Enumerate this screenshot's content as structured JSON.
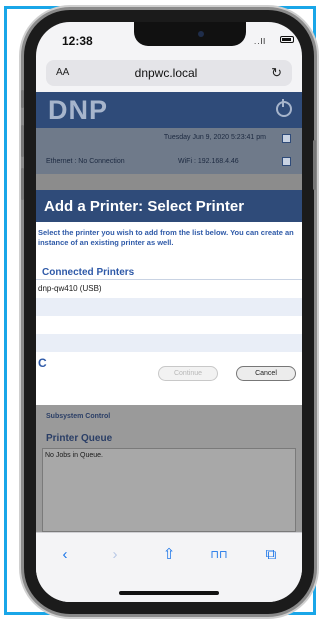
{
  "status": {
    "time": "12:38",
    "signal": "..ll"
  },
  "browser": {
    "text_size_label": "AA",
    "url": "dnpwc.local",
    "reload_icon": "reload-icon"
  },
  "header": {
    "logo": "DNP",
    "power_icon": "power-icon"
  },
  "info": {
    "datetime": "Tuesday Jun 9, 2020 5:23:41 pm",
    "ethernet": "Ethernet : No Connection",
    "wifi": "WiFi : 192.168.4.46"
  },
  "modal": {
    "title": "Add a Printer: Select Printer",
    "description": "Select the printer you wish to add from the list below. You can create an instance of an existing printer as well.",
    "section_title": "Connected Printers",
    "printers": [
      "dnp-qw410 (USB)",
      "",
      "",
      "",
      ""
    ],
    "spinner": "C",
    "continue_label": "Continue",
    "cancel_label": "Cancel"
  },
  "background": {
    "subsystem_control": "Subsystem Control",
    "printer_queue_title": "Printer Queue",
    "printer_queue_text": "No Jobs in Queue."
  },
  "toolbar": {
    "back": "‹",
    "forward": "›",
    "share": "⇧",
    "bookmarks": "⊓⊓",
    "tabs": "⧉"
  },
  "colors": {
    "border": "#19a6e8",
    "brand": "#2f4b79",
    "accent": "#2f5aa8"
  }
}
